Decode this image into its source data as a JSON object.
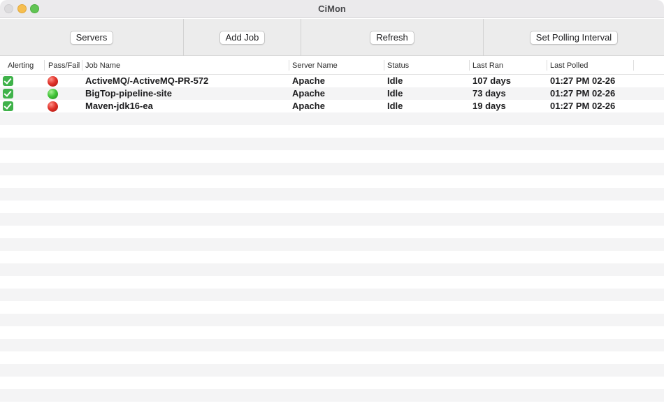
{
  "window": {
    "title": "CiMon"
  },
  "toolbar": {
    "servers_label": "Servers",
    "add_job_label": "Add Job",
    "refresh_label": "Refresh",
    "set_polling_label": "Set Polling Interval"
  },
  "table": {
    "columns": [
      "Alerting",
      "Pass/Fail",
      "Job Name",
      "Server Name",
      "Status",
      "Last Ran",
      "Last Polled"
    ],
    "rows": [
      {
        "alerting": "checked",
        "pass_fail": "fail",
        "job_name": "ActiveMQ/-ActiveMQ-PR-572",
        "server_name": "Apache",
        "status": "Idle",
        "last_ran": "107 days",
        "last_polled": "01:27 PM 02-26"
      },
      {
        "alerting": "checked",
        "pass_fail": "pass",
        "job_name": "BigTop-pipeline-site",
        "server_name": "Apache",
        "status": "Idle",
        "last_ran": "73 days",
        "last_polled": "01:27 PM 02-26"
      },
      {
        "alerting": "checked",
        "pass_fail": "fail",
        "job_name": "Maven-jdk16-ea",
        "server_name": "Apache",
        "status": "Idle",
        "last_ran": "19 days",
        "last_polled": "01:27 PM 02-26"
      }
    ]
  },
  "colors": {
    "pass": "#43c43a",
    "fail": "#e0332a",
    "alert_check": "#3fb24a"
  },
  "icons": {
    "alerting": "check-box-icon",
    "pass": "green-status-dot-icon",
    "fail": "red-status-dot-icon"
  }
}
